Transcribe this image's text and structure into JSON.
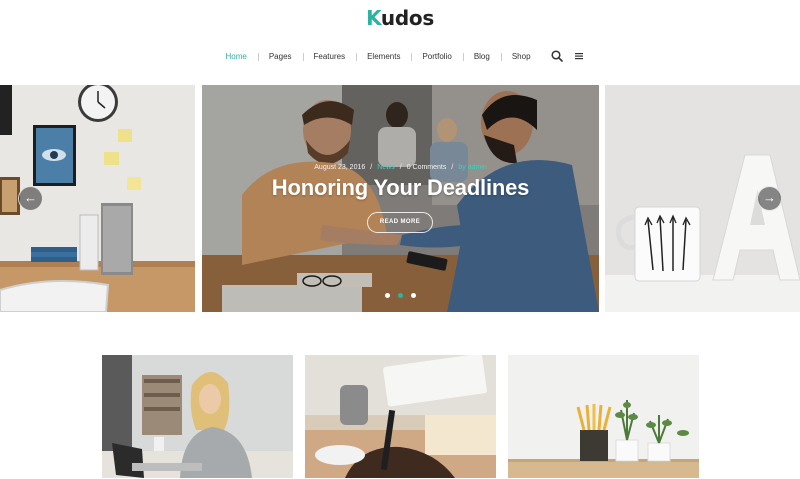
{
  "brand": {
    "logo_first": "K",
    "logo_rest": "udos",
    "accent_color": "#2bb3a3"
  },
  "nav": {
    "items": [
      "Home",
      "Pages",
      "Features",
      "Elements",
      "Portfolio",
      "Blog",
      "Shop"
    ],
    "active": "Home",
    "icons": [
      "search-icon",
      "menu-icon"
    ]
  },
  "hero": {
    "date": "August 23, 2016",
    "category": "News",
    "comments": "0 Comments",
    "author": "by admin",
    "title": "Honoring Your Deadlines",
    "button": "READ MORE",
    "slides": 3,
    "active_slide": 2
  },
  "cards": [
    {
      "image": "woman-laughing-at-laptop"
    },
    {
      "image": "hand-writing-with-pen"
    },
    {
      "image": "pencils-and-plants"
    }
  ]
}
